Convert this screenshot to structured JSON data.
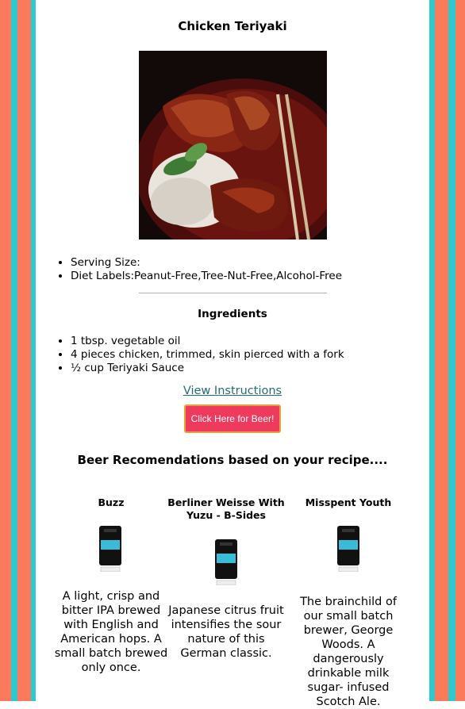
{
  "colors": {
    "coral": "#fb7a5c",
    "teal": "#2ec9cf",
    "button_bg": "#ee3a5c",
    "button_border": "#e6a33a",
    "link": "#1f6f6f"
  },
  "recipe": {
    "title": "Chicken Teriyaki",
    "image_icon": "chicken-teriyaki-photo",
    "info": [
      "Serving Size:",
      "Diet Labels:Peanut-Free,Tree-Nut-Free,Alcohol-Free"
    ],
    "ingredients_heading": "Ingredients",
    "ingredients": [
      "1 tbsp. vegetable oil",
      "4 pieces chicken, trimmed, skin pierced with a fork",
      "½ cup Teriyaki Sauce"
    ],
    "instructions_link": "View Instructions",
    "beer_button": "Click Here for Beer!"
  },
  "recommendations": {
    "heading": "Beer Recomendations based on your recipe....",
    "beers": [
      {
        "name": "Buzz",
        "description": "A light, crisp and bitter IPA brewed with English and American hops. A small batch brewed only once."
      },
      {
        "name": "Berliner Weisse With Yuzu - B-Sides",
        "description": "Japanese citrus fruit intensifies the sour nature of this German classic."
      },
      {
        "name": "Misspent Youth",
        "description": "The brainchild of our small batch brewer, George Woods. A dangerously drinkable milk sugar- infused Scotch Ale."
      }
    ]
  }
}
